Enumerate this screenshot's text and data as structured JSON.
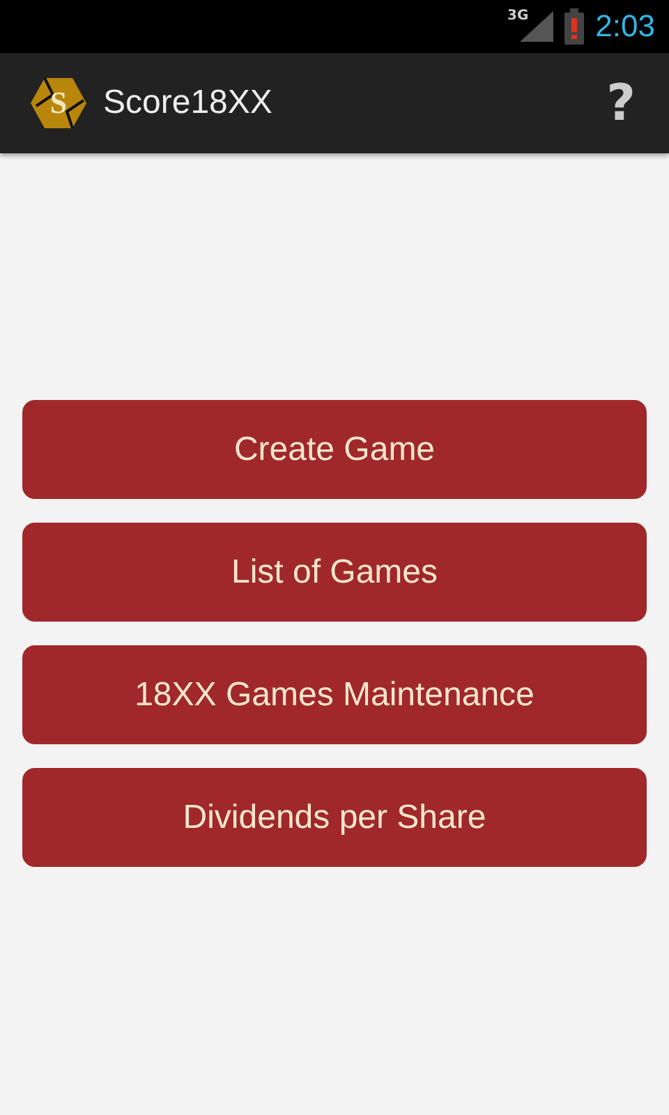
{
  "status_bar": {
    "network": "3G",
    "time": "2:03"
  },
  "action_bar": {
    "logo_letter": "S",
    "title": "Score18XX",
    "help": "?"
  },
  "buttons": [
    "Create Game",
    "List of Games",
    "18XX Games Maintenance",
    "Dividends per Share"
  ]
}
